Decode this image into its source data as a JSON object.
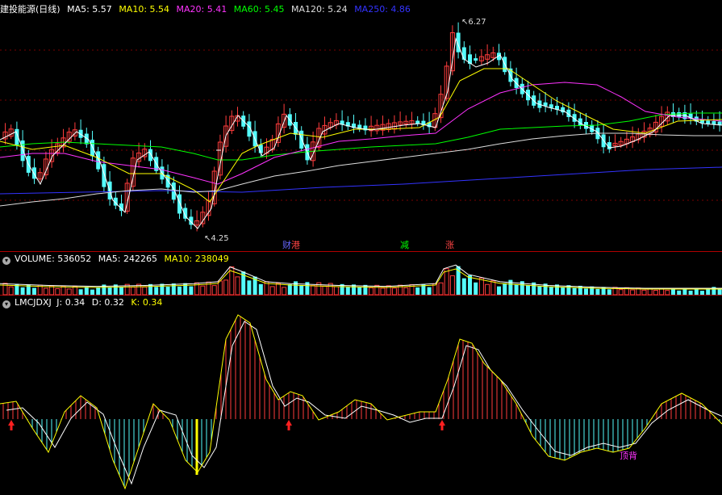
{
  "header": {
    "name": "建投能源(日线)",
    "ma": [
      {
        "label": "MA5: 5.57",
        "color": "#ffffff"
      },
      {
        "label": "MA10: 5.54",
        "color": "#ffff00"
      },
      {
        "label": "MA20: 5.41",
        "color": "#ff33ff"
      },
      {
        "label": "MA60: 5.45",
        "color": "#00ff00"
      },
      {
        "label": "MA120: 5.24",
        "color": "#dddddd"
      },
      {
        "label": "MA250: 4.86",
        "color": "#3333ff"
      }
    ]
  },
  "price_marks": {
    "high": "6.27",
    "low": "4.25"
  },
  "events": [
    {
      "label": "财",
      "color": "#6666ff"
    },
    {
      "label": "港",
      "color": "#ff4444"
    },
    {
      "label": "减",
      "color": "#00ff00"
    },
    {
      "label": "涨",
      "color": "#ff4444"
    }
  ],
  "volume_header": {
    "title": "VOLUME: 536052",
    "ma5": "MA5: 242265",
    "ma10": "MA10: 238049"
  },
  "kdj_header": {
    "name": "LMCJDXJ",
    "j": "J: 0.34",
    "d": "D: 0.32",
    "k": "K: 0.34"
  },
  "kdj_note": "顶背",
  "colors": {
    "up": "#ff3c3c",
    "down": "#54fcfc",
    "ma5": "#ffffff",
    "ma10": "#ffff00",
    "ma20": "#ff33ff",
    "ma60": "#00ff00",
    "ma120": "#dddddd",
    "ma250": "#3333ff",
    "grid": "#7a0000"
  }
}
